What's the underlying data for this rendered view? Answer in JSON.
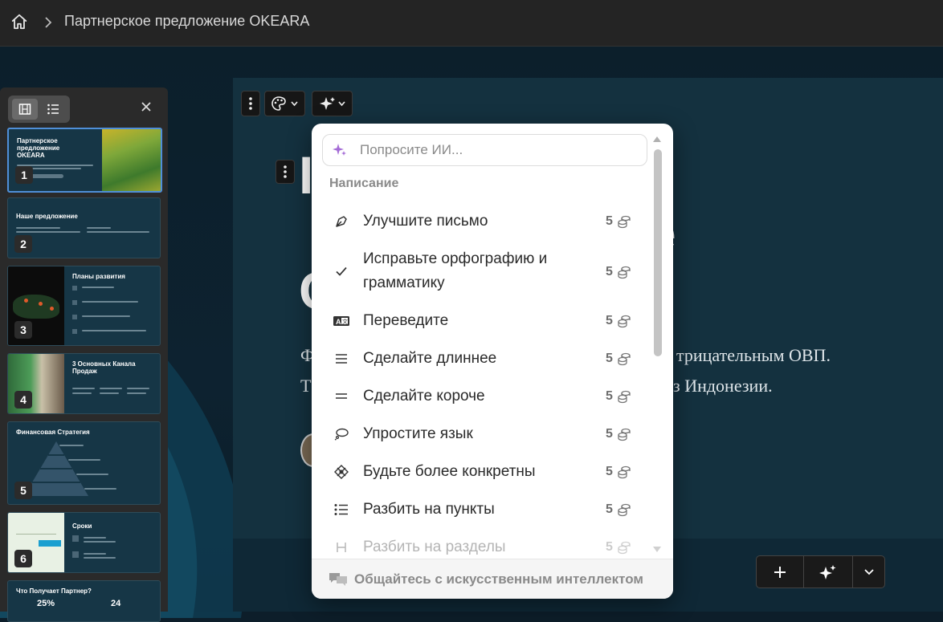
{
  "header": {
    "title": "Партнерское предложение OKEARA"
  },
  "slide": {
    "visible_fragments": {
      "letter_top": "I",
      "letter_mid": "e",
      "letter_c": "C",
      "line1_start": "Ф",
      "line1_end": "трицательным ОВП.",
      "line2_start": "Т",
      "line2_end": "з Индонезии."
    }
  },
  "panel": {
    "thumbnails": [
      {
        "number": "1",
        "title": "Партнерское предложение OKEARA"
      },
      {
        "number": "2",
        "title": "Наше предложение"
      },
      {
        "number": "3",
        "title": "Планы развития"
      },
      {
        "number": "4",
        "title": "3 Основных Канала Продаж"
      },
      {
        "number": "5",
        "title": "Финансовая Стратегия"
      },
      {
        "number": "6",
        "title": "Сроки"
      },
      {
        "number": "",
        "title": "Что Получает Партнер?",
        "stat1": "25%",
        "stat2": "24"
      }
    ]
  },
  "ai_popup": {
    "placeholder": "Попросите ИИ...",
    "section_label": "Написание",
    "items": [
      {
        "label": "Улучшите письмо",
        "cost": "5",
        "icon": "pen-nib-icon"
      },
      {
        "label": "Исправьте орфографию и грамматику",
        "label_line1": "Исправьте орфографию и",
        "label_line2": "грамматику",
        "cost": "5",
        "icon": "check-icon"
      },
      {
        "label": "Переведите",
        "cost": "5",
        "icon": "translate-icon"
      },
      {
        "label": "Сделайте длиннее",
        "cost": "5",
        "icon": "lines-long-icon"
      },
      {
        "label": "Сделайте короче",
        "cost": "5",
        "icon": "lines-short-icon"
      },
      {
        "label": "Упростите язык",
        "cost": "5",
        "icon": "speech-bubble-icon"
      },
      {
        "label": "Будьте более конкретны",
        "cost": "5",
        "icon": "target-icon"
      },
      {
        "label": "Разбить на пункты",
        "cost": "5",
        "icon": "bullet-list-icon"
      },
      {
        "label": "Разбить на разделы",
        "cost": "5",
        "icon": "heading-icon"
      }
    ],
    "footer_label": "Общайтесь с искусственным интеллектом"
  }
}
